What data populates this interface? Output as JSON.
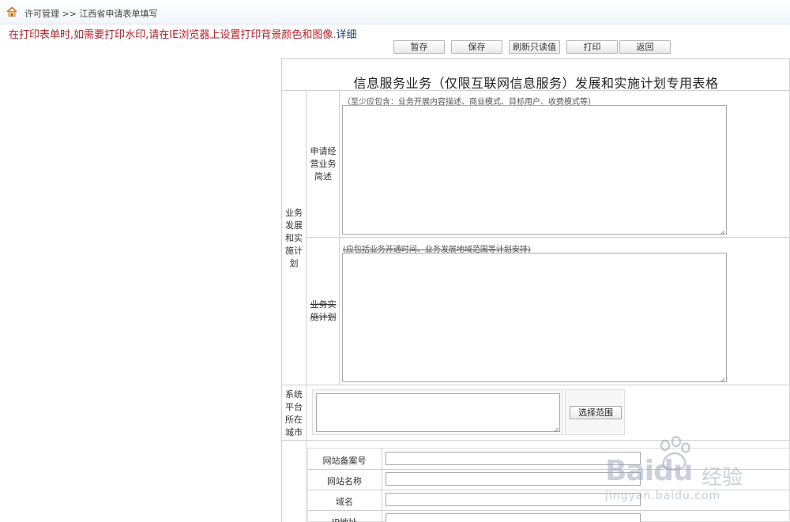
{
  "breadcrumb": {
    "text": "许可管理 >> 江西省申请表单填写"
  },
  "notice": {
    "text": "在打印表单时,如需要打印水印,请在IE浏览器上设置打印背景颜色和图像.",
    "detail_link": "详细"
  },
  "toolbar": {
    "temp_save_label": "暂存",
    "save_label": "保存",
    "refresh_label": "刷新只读值",
    "print_label": "打印",
    "back_label": "返回"
  },
  "form": {
    "title": "信息服务业务（仅限互联网信息服务）发展和实施计划专用表格",
    "section_label": "业务发展和实施计划",
    "business_desc": {
      "label": "申请经营业务简述",
      "hint": "（至少应包含：业务开展内容描述、商业模式、目标用户、收费模式等）",
      "value": ""
    },
    "business_plan": {
      "label": "业务实施计划",
      "hint": "(应包括业务开通时间、业务发展地域范围等计划安排)",
      "value": ""
    },
    "platform_city": {
      "label": "系统平台所在城市",
      "value": "",
      "select_button_label": "选择范围"
    },
    "website": {
      "record_number_label": "网站备案号",
      "name_label": "网站名称",
      "domain_label": "域名",
      "ip_label": "IP地址",
      "record_number_value": "",
      "name_value": "",
      "domain_value": "",
      "ip_value": ""
    }
  },
  "watermark": {
    "brand": "Baidu",
    "jingyan": "经验",
    "url": "jingyan.baidu.com"
  },
  "colors": {
    "notice_red": "#b3232a",
    "detail_blue": "#1a3f8c",
    "border_gray": "#d0d0d0"
  }
}
